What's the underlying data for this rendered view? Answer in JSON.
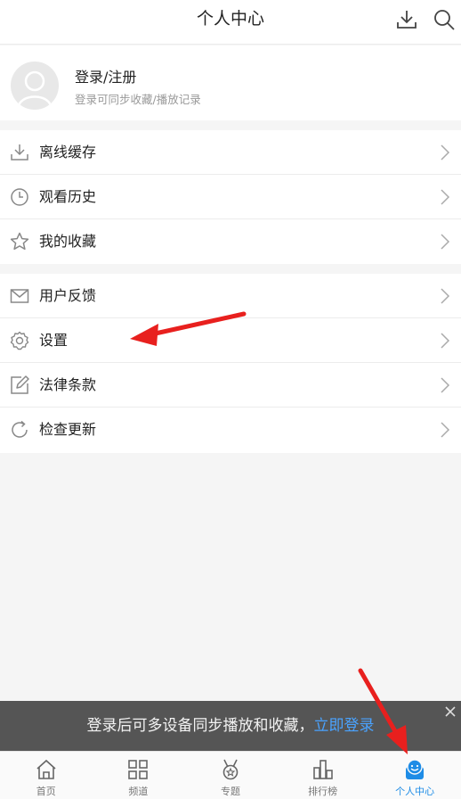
{
  "header": {
    "title": "个人中心",
    "download_icon": "download-icon",
    "search_icon": "search-icon"
  },
  "profile": {
    "title": "登录/注册",
    "subtitle": "登录可同步收藏/播放记录",
    "avatar_icon": "avatar-placeholder-icon"
  },
  "menu_group_1": [
    {
      "label": "离线缓存",
      "icon": "download-icon"
    },
    {
      "label": "观看历史",
      "icon": "clock-icon"
    },
    {
      "label": "我的收藏",
      "icon": "star-icon"
    }
  ],
  "menu_group_2": [
    {
      "label": "用户反馈",
      "icon": "mail-icon"
    },
    {
      "label": "设置",
      "icon": "gear-icon"
    },
    {
      "label": "法律条款",
      "icon": "edit-icon"
    },
    {
      "label": "检查更新",
      "icon": "refresh-icon"
    }
  ],
  "banner": {
    "text": "登录后可多设备同步播放和收藏，",
    "link": "立即登录"
  },
  "tabbar": [
    {
      "label": "首页",
      "icon": "home-icon",
      "active": false
    },
    {
      "label": "频道",
      "icon": "grid-icon",
      "active": false
    },
    {
      "label": "专题",
      "icon": "medal-icon",
      "active": false
    },
    {
      "label": "排行榜",
      "icon": "ranking-icon",
      "active": false
    },
    {
      "label": "个人中心",
      "icon": "smiley-profile-icon",
      "active": true
    }
  ],
  "colors": {
    "accent": "#1e8ce6",
    "annotation_arrow": "#e8201e",
    "banner_link": "#4aa3ff"
  }
}
